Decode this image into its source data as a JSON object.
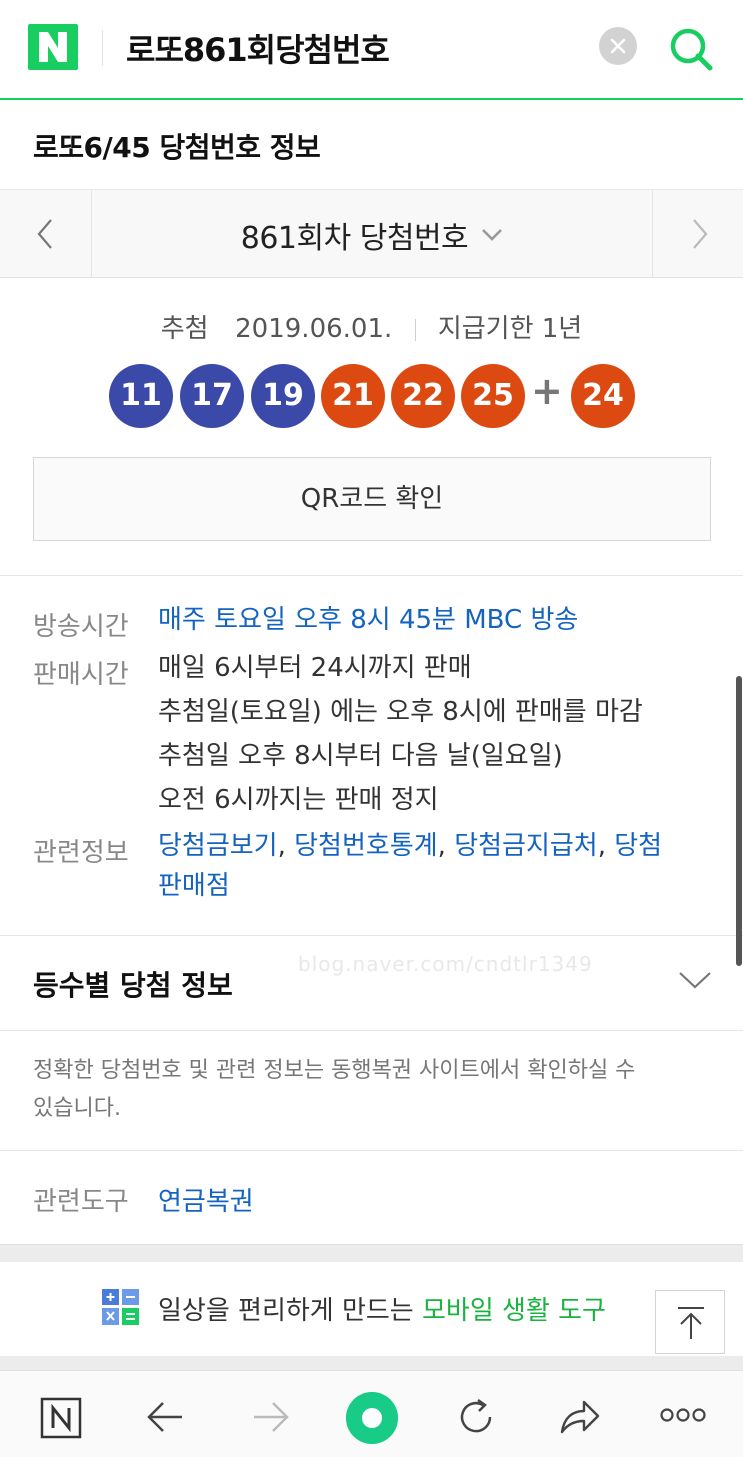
{
  "header": {
    "logo_letter": "N",
    "query": "로또861회당첨번호",
    "clear_icon": "clear-x-icon",
    "search_icon": "search-icon",
    "brand_color": "#19ce60"
  },
  "title": "로또6/45 당첨번호 정보",
  "round_nav": {
    "label": "861회차 당첨번호"
  },
  "draw": {
    "draw_label": "추첨",
    "draw_date": "2019.06.01.",
    "deadline": "지급기한 1년"
  },
  "balls": [
    {
      "number": "11",
      "color": "#3b4aa8"
    },
    {
      "number": "17",
      "color": "#3b4aa8"
    },
    {
      "number": "19",
      "color": "#3b4aa8"
    },
    {
      "number": "21",
      "color": "#dc4a12"
    },
    {
      "number": "22",
      "color": "#dc4a12"
    },
    {
      "number": "25",
      "color": "#dc4a12"
    }
  ],
  "plus": "+",
  "bonus": {
    "number": "24",
    "color": "#dc4a12"
  },
  "qr_button": "QR코드 확인",
  "info": {
    "broadcast_label": "방송시간",
    "broadcast_value": "매주 토요일 오후 8시 45분 MBC 방송",
    "sales_label": "판매시간",
    "sales_lines": [
      "매일 6시부터 24시까지 판매",
      "추첨일(토요일) 에는 오후 8시에 판매를 마감",
      "추첨일 오후 8시부터 다음 날(일요일)",
      "오전 6시까지는 판매 정지"
    ],
    "related_label": "관련정보",
    "related_links": [
      "당첨금보기",
      "당첨번호통계",
      "당첨금지급처",
      "당첨"
    ],
    "related_sep": ",",
    "related_last": "판매점"
  },
  "rank": {
    "title": "등수별 당첨 정보",
    "watermark": "blog.naver.com/cndtlr1349"
  },
  "notice_lines": [
    "정확한 당첨번호 및 관련 정보는 동행복권 사이트에서 확인하실 수",
    "있습니다."
  ],
  "tools": {
    "label": "관련도구",
    "value": "연금복권"
  },
  "banner": {
    "text": "일상을 편리하게 만드는",
    "highlight": "모바일 생활 도구"
  },
  "bottom_bar": {
    "items": [
      "naver-home-icon",
      "back-arrow-icon",
      "forward-arrow-icon",
      "green-dot-icon",
      "refresh-icon",
      "share-icon",
      "more-icon"
    ]
  }
}
